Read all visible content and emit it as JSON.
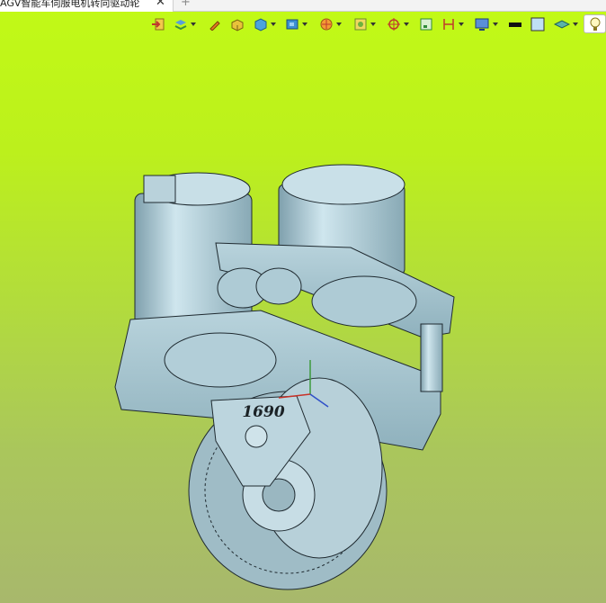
{
  "tab": {
    "title": "AGV智能车伺服电机转向驱动轮",
    "close": "✕",
    "new_tab": "+"
  },
  "toolbar": {
    "tools": [
      {
        "name": "import-icon",
        "dropdown": false
      },
      {
        "name": "layers-icon",
        "dropdown": true
      },
      {
        "name": "pencil-icon",
        "dropdown": false
      },
      {
        "name": "part-icon",
        "dropdown": false
      },
      {
        "name": "cube-icon",
        "dropdown": true
      },
      {
        "name": "view-icon",
        "dropdown": true
      },
      {
        "name": "section-icon",
        "dropdown": true
      },
      {
        "name": "render-icon",
        "dropdown": true
      },
      {
        "name": "orient-icon",
        "dropdown": true
      },
      {
        "name": "snapshot-icon",
        "dropdown": false
      },
      {
        "name": "measure-icon",
        "dropdown": true
      },
      {
        "name": "display-icon",
        "dropdown": true
      },
      {
        "name": "line-color-icon",
        "dropdown": false
      },
      {
        "name": "fill-color-icon",
        "dropdown": false
      },
      {
        "name": "plane-icon",
        "dropdown": true
      },
      {
        "name": "lightbulb-icon",
        "dropdown": false
      }
    ]
  },
  "model": {
    "label": "1690"
  },
  "colors": {
    "background_top": "#c2fa16",
    "background_bottom": "#a8b86c",
    "part": "#a8c6d0",
    "edge": "#1f2a30"
  }
}
